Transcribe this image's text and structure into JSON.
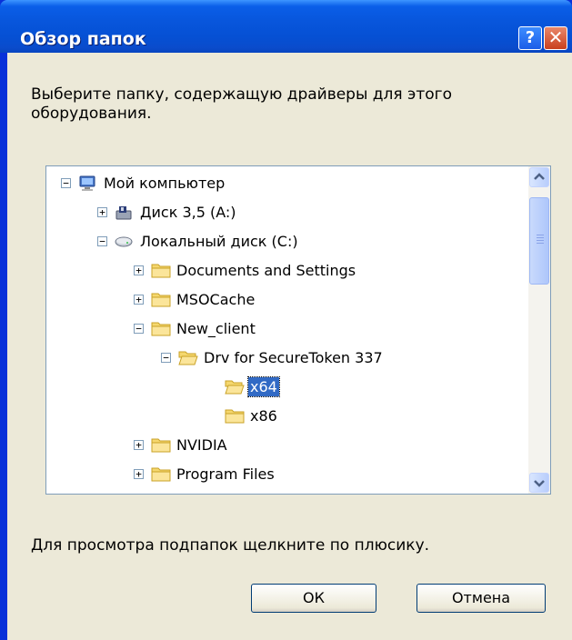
{
  "window": {
    "title": "Обзор папок",
    "help_glyph": "?",
    "close_glyph": "✕"
  },
  "prompt": "Выберите папку, содержащую драйверы для этого оборудования.",
  "tree": {
    "items": [
      {
        "label": "Мой компьютер",
        "expander": "−",
        "icon": "computer-icon"
      },
      {
        "label": "Диск 3,5 (A:)",
        "expander": "+",
        "icon": "floppy-icon"
      },
      {
        "label": "Локальный диск (C:)",
        "expander": "−",
        "icon": "hard-drive-icon"
      },
      {
        "label": "Documents and Settings",
        "expander": "+",
        "icon": "folder-icon"
      },
      {
        "label": "MSOCache",
        "expander": "+",
        "icon": "folder-icon"
      },
      {
        "label": "New_client",
        "expander": "−",
        "icon": "folder-icon"
      },
      {
        "label": "Drv for SecureToken 337",
        "expander": "−",
        "icon": "folder-open-icon"
      },
      {
        "label": "x64",
        "expander": "",
        "icon": "folder-open-icon",
        "selected": true
      },
      {
        "label": "x86",
        "expander": "",
        "icon": "folder-icon"
      },
      {
        "label": "NVIDIA",
        "expander": "+",
        "icon": "folder-icon"
      },
      {
        "label": "Program Files",
        "expander": "+",
        "icon": "folder-icon"
      }
    ]
  },
  "hint": "Для просмотра подпапок щелкните по плюсику.",
  "buttons": {
    "ok": "ОК",
    "cancel": "Отмена"
  },
  "colors": {
    "title_bar": "#0a5ee8",
    "dialog_bg": "#ece9d8",
    "selection": "#316ac5",
    "folder": "#f5d76e"
  }
}
